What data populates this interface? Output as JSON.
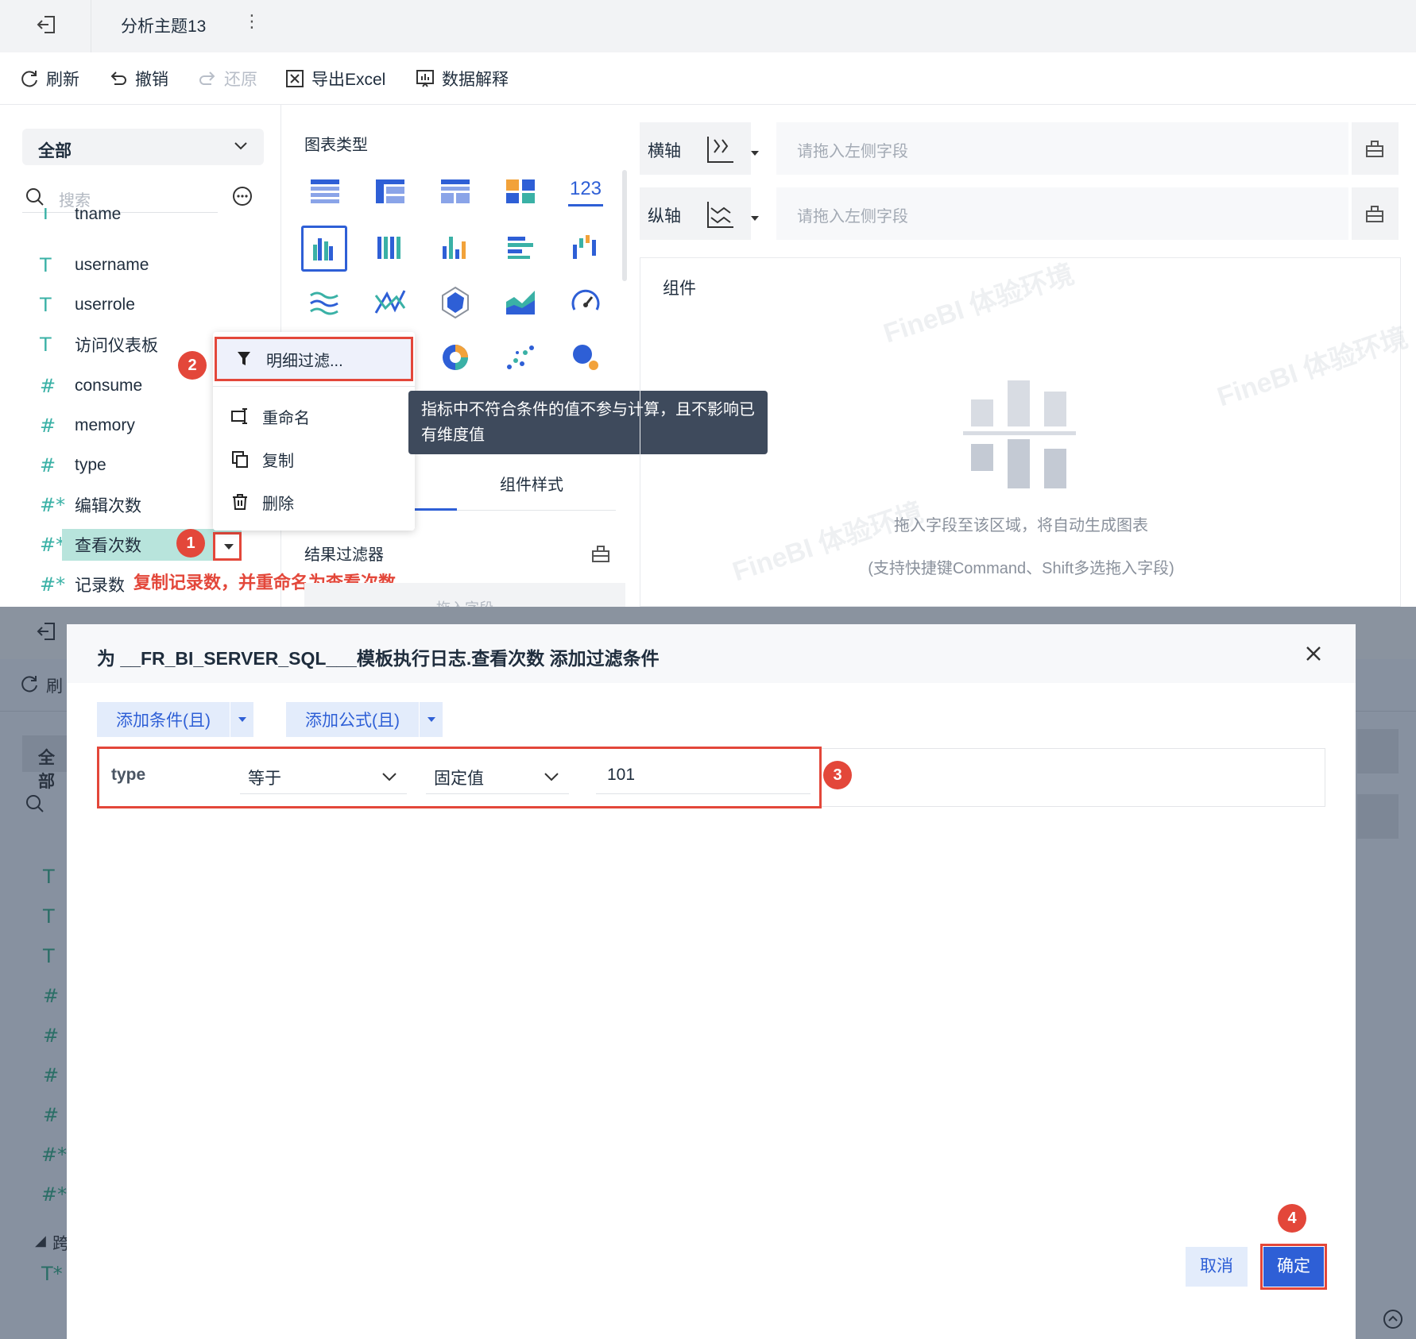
{
  "top": {
    "tab_title": "分析主题13",
    "more": "⋮",
    "toolbar": {
      "refresh": "刷新",
      "undo": "撤销",
      "redo": "还原",
      "export": "导出Excel",
      "explain": "数据解释"
    },
    "left": {
      "dropdown": "全部",
      "search_placeholder": "搜索",
      "fields": [
        {
          "icon": "T",
          "name": "tname"
        },
        {
          "icon": "T",
          "name": "username"
        },
        {
          "icon": "T",
          "name": "userrole"
        },
        {
          "icon": "T",
          "name": "访问仪表板"
        },
        {
          "icon": "#",
          "name": "consume"
        },
        {
          "icon": "#",
          "name": "memory"
        },
        {
          "icon": "#",
          "name": "type"
        },
        {
          "icon": "#*",
          "name": "编辑次数"
        },
        {
          "icon": "#*",
          "name": "查看次数"
        },
        {
          "icon": "#*",
          "name": "记录数"
        }
      ],
      "annotation": "复制记录数，并重命名为查看次数"
    },
    "context_menu": {
      "items": [
        "明细过滤...",
        "重命名",
        "复制",
        "删除"
      ]
    },
    "tooltip": "指标中不符合条件的值不参与计算，且不影响已有维度值",
    "middle": {
      "chart_type_label": "图表类型",
      "number_icon": "123",
      "tab_style": "组件样式",
      "result_filter": "结果过滤器",
      "drop_field": "拖入字段"
    },
    "right": {
      "x_axis": "横轴",
      "y_axis": "纵轴",
      "axis_placeholder": "请拖入左侧字段",
      "component": "组件",
      "hint1": "拖入字段至该区域，将自动生成图表",
      "hint2": "(支持快捷键Command、Shift多选拖入字段)",
      "watermark": "FineBI 体验环境"
    },
    "badges": [
      "1",
      "2"
    ]
  },
  "bottom": {
    "bg": {
      "refresh_partial": "刷",
      "all_partial": "全部",
      "cross_partial": "跨"
    },
    "modal": {
      "title": "为 __FR_BI_SERVER_SQL___模板执行日志.查看次数 添加过滤条件",
      "add_condition": "添加条件(且)",
      "add_formula": "添加公式(且)",
      "condition": {
        "field": "type",
        "operator": "等于",
        "value_type": "固定值",
        "value": "101"
      },
      "cancel": "取消",
      "ok": "确定"
    },
    "badges": [
      "3",
      "4"
    ]
  },
  "colors": {
    "accent": "#2e5fd6",
    "highlight_red": "#e3473a",
    "field_teal": "#3ab1a6",
    "selected_field_bg": "#b8e4dc"
  }
}
